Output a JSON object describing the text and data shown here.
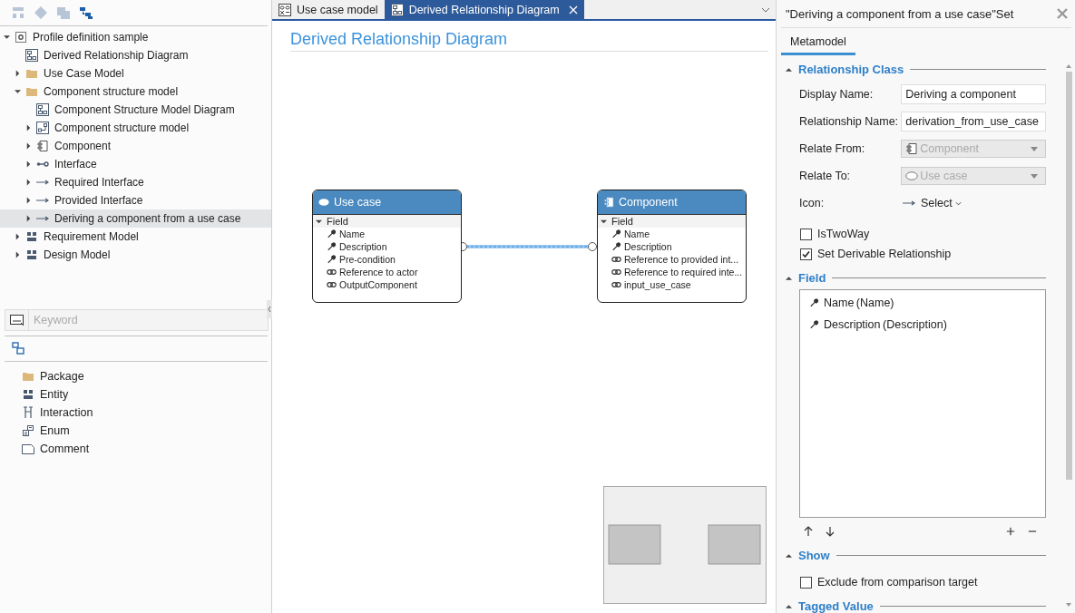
{
  "toolbar": [
    {
      "kind": "layout",
      "disabled": true
    },
    {
      "kind": "diamond",
      "disabled": true
    },
    {
      "kind": "stack",
      "disabled": true
    },
    {
      "kind": "tree",
      "disabled": false
    }
  ],
  "tree": [
    {
      "label": "Profile definition sample",
      "kind": "profile",
      "expanded": true,
      "selected": false,
      "children": [
        {
          "label": "Derived Relationship Diagram",
          "kind": "diagram",
          "selected": false
        },
        {
          "label": "Use Case Model",
          "kind": "folder",
          "expanded": false,
          "selected": false
        },
        {
          "label": "Component structure model",
          "kind": "folder",
          "expanded": true,
          "selected": false,
          "children": [
            {
              "label": "Component Structure Model Diagram",
              "kind": "diagram",
              "selected": false
            },
            {
              "label": "Component structure model",
              "kind": "structure",
              "expanded": false,
              "selected": false
            },
            {
              "label": "Component",
              "kind": "component",
              "expanded": false,
              "selected": false
            },
            {
              "label": "Interface",
              "kind": "interface",
              "expanded": false,
              "selected": false
            },
            {
              "label": "Required Interface",
              "kind": "arrow",
              "expanded": false,
              "selected": false
            },
            {
              "label": "Provided Interface",
              "kind": "arrow",
              "expanded": false,
              "selected": false
            },
            {
              "label": "Deriving a component from a use case",
              "kind": "arrow",
              "expanded": false,
              "selected": true
            }
          ]
        },
        {
          "label": "Requirement Model",
          "kind": "entity",
          "expanded": false,
          "selected": false
        },
        {
          "label": "Design Model",
          "kind": "entity",
          "expanded": false,
          "selected": false
        }
      ]
    }
  ],
  "search": {
    "placeholder": "Keyword"
  },
  "palette": [
    {
      "label": "Package",
      "kind": "folder"
    },
    {
      "label": "Entity",
      "kind": "entity"
    },
    {
      "label": "Interaction",
      "kind": "interaction"
    },
    {
      "label": "Enum",
      "kind": "enum"
    },
    {
      "label": "Comment",
      "kind": "comment"
    }
  ],
  "editor_tabs": [
    {
      "label": "Use case model",
      "kind": "usecase",
      "selected": false
    },
    {
      "label": "Derived Relationship Diagram",
      "kind": "diagram",
      "selected": true
    }
  ],
  "diagram": {
    "title": "Derived Relationship Diagram",
    "nodes": [
      {
        "title": "Use case",
        "kind": "ellipse",
        "group": "Field",
        "expanded": true,
        "fields": [
          {
            "label": "Name",
            "kind": "attribute"
          },
          {
            "label": "Description",
            "kind": "attribute"
          },
          {
            "label": "Pre-condition",
            "kind": "attribute"
          },
          {
            "label": "Reference to actor",
            "kind": "reference"
          },
          {
            "label": "OutputComponent",
            "kind": "reference"
          }
        ]
      },
      {
        "title": "Component",
        "kind": "component",
        "group": "Field",
        "expanded": true,
        "fields": [
          {
            "label": "Name",
            "kind": "attribute"
          },
          {
            "label": "Description",
            "kind": "attribute"
          },
          {
            "label": "Reference to provided int...",
            "kind": "reference"
          },
          {
            "label": "Reference to required inte...",
            "kind": "reference"
          },
          {
            "label": "input_use_case",
            "kind": "reference"
          }
        ]
      }
    ]
  },
  "properties": {
    "title": "\"Deriving a component from a use case\"Set",
    "tabs": [
      {
        "label": "Metamodel",
        "selected": true
      }
    ],
    "sections": [
      {
        "title": "Relationship Class",
        "expanded": true,
        "rows": [
          {
            "label": "Display Name:",
            "kind": "text",
            "value": "Deriving a component"
          },
          {
            "label": "Relationship Name:",
            "kind": "text",
            "value": "derivation_from_use_case"
          },
          {
            "label": "Relate From:",
            "kind": "select",
            "value": "Component",
            "disabled": true
          },
          {
            "label": "Relate To:",
            "kind": "select",
            "value": "Use case",
            "disabled": true
          },
          {
            "label": "Icon:",
            "kind": "iconselect",
            "value": "Select"
          }
        ],
        "checkboxes": [
          {
            "label": "IsTwoWay",
            "checked": false
          },
          {
            "label": "Set Derivable Relationship",
            "checked": true
          }
        ]
      },
      {
        "title": "Field",
        "expanded": true,
        "list": [
          {
            "label": "Name (Name)"
          },
          {
            "label": "Description (Description)"
          }
        ]
      },
      {
        "title": "Show",
        "expanded": true,
        "checkboxes": [
          {
            "label": "Exclude from comparison target",
            "checked": false
          }
        ]
      },
      {
        "title": "Tagged Value",
        "expanded": true
      }
    ]
  }
}
